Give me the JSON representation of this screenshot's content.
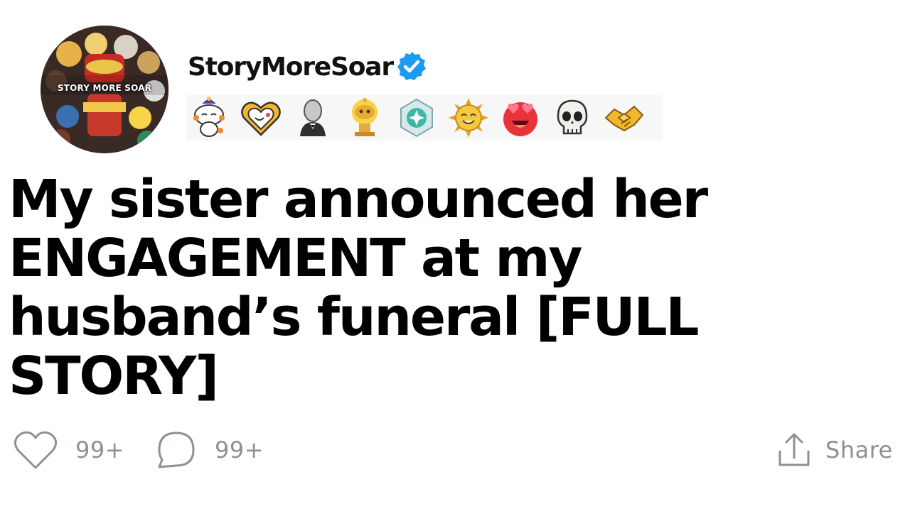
{
  "header": {
    "avatar_text": "STORY MORE SOAR",
    "username": "StoryMoreSoar",
    "verified_icon": "verified-check-icon",
    "badges": [
      {
        "icon": "sleepy-snoo-icon"
      },
      {
        "icon": "heart-face-icon"
      },
      {
        "icon": "gentleman-bust-icon"
      },
      {
        "icon": "gold-trophy-snoo-icon"
      },
      {
        "icon": "teal-gem-icon"
      },
      {
        "icon": "sun-face-icon"
      },
      {
        "icon": "heart-eyes-icon"
      },
      {
        "icon": "skull-icon"
      },
      {
        "icon": "handshake-icon"
      }
    ]
  },
  "post": {
    "title": "My sister announced her ENGAGEMENT at my husband’s funeral [FULL STORY]"
  },
  "actions": {
    "like_count": "99+",
    "comment_count": "99+",
    "share_label": "Share"
  },
  "colors": {
    "verified_blue": "#1d9bf0",
    "action_gray": "#8b9198",
    "title": "#000000"
  }
}
